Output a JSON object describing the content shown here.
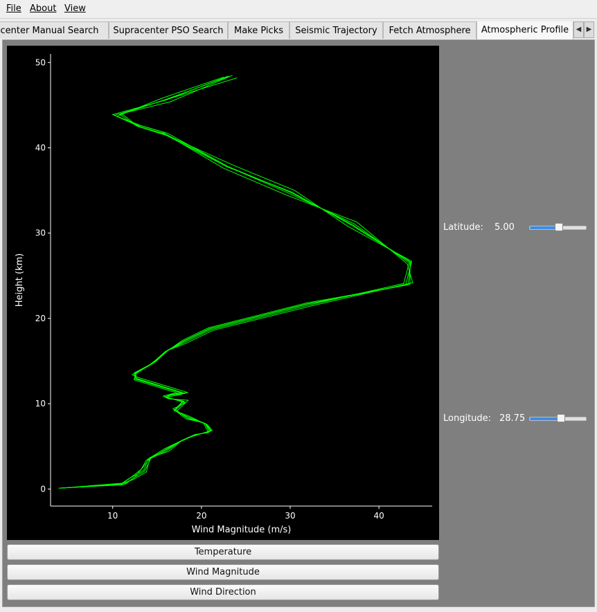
{
  "menu": {
    "file": "File",
    "about": "About",
    "view": "View"
  },
  "tabs": [
    {
      "label": "Supracenter Manual Search"
    },
    {
      "label": "Supracenter PSO Search"
    },
    {
      "label": "Make Picks"
    },
    {
      "label": "Seismic Trajectory"
    },
    {
      "label": "Fetch Atmosphere"
    },
    {
      "label": "Atmospheric Profile"
    }
  ],
  "tab_scroll": {
    "left_icon": "triangle-left",
    "right_icon": "triangle-right"
  },
  "buttons": {
    "temperature": "Temperature",
    "wind_magnitude": "Wind Magnitude",
    "wind_direction": "Wind Direction"
  },
  "controls": {
    "latitude_label": "Latitude:",
    "latitude_value": "5.00",
    "latitude_position": 0.52,
    "longitude_label": "Longitude:",
    "longitude_value": "28.75",
    "longitude_position": 0.56
  },
  "colors": {
    "plot_background": "#000000",
    "line": "#00ff00",
    "axis": "#ffffff",
    "slider_fill": "#3a8ee6",
    "panel": "#7f7f7f"
  },
  "chart_data": {
    "type": "line",
    "xlabel": "Wind Magnitude (m/s)",
    "ylabel": "Height (km)",
    "xlim": [
      3,
      46
    ],
    "ylim": [
      -2,
      51
    ],
    "xticks": [
      10,
      20,
      30,
      40
    ],
    "yticks": [
      0,
      10,
      20,
      30,
      40,
      50
    ],
    "grid": false,
    "series": [
      {
        "x": [
          4.0,
          11.0,
          12.0,
          13.5,
          14.0,
          16.0,
          17.5,
          19.0,
          21.0,
          20.5,
          18.5,
          17.0,
          18.0,
          16.0,
          16.5,
          18.0,
          12.5,
          12.5,
          14.5,
          16.0,
          18.0,
          21.0,
          32.0,
          43.5,
          43.5,
          37.0,
          30.0,
          23.0,
          16.0,
          13.0,
          10.0,
          16.0,
          23.0
        ],
        "y": [
          0.1,
          0.6,
          1.3,
          2.2,
          3.5,
          4.6,
          5.5,
          6.2,
          6.8,
          7.6,
          8.4,
          9.2,
          10.3,
          10.7,
          11.0,
          11.2,
          12.9,
          13.5,
          14.7,
          16.1,
          17.3,
          18.8,
          21.7,
          24.0,
          26.6,
          31.0,
          34.8,
          37.8,
          41.6,
          42.5,
          43.9,
          45.6,
          48.4
        ]
      },
      {
        "x": [
          4.2,
          11.2,
          12.3,
          13.8,
          14.2,
          16.3,
          17.8,
          19.3,
          20.8,
          20.2,
          18.3,
          16.8,
          18.2,
          15.7,
          16.8,
          18.5,
          12.8,
          12.2,
          14.8,
          16.3,
          18.3,
          21.3,
          32.5,
          43.8,
          43.2,
          37.5,
          29.5,
          22.5,
          15.5,
          12.5,
          11.0,
          16.5,
          23.5
        ],
        "y": [
          0.1,
          0.7,
          1.1,
          2.0,
          3.7,
          4.4,
          5.7,
          6.4,
          6.6,
          7.8,
          8.2,
          9.4,
          10.1,
          10.9,
          11.2,
          11.3,
          13.1,
          13.4,
          14.9,
          16.3,
          17.1,
          18.6,
          21.5,
          24.2,
          26.4,
          31.3,
          34.5,
          37.6,
          41.9,
          42.8,
          44.0,
          45.4,
          48.5
        ]
      },
      {
        "x": [
          3.9,
          10.8,
          12.1,
          13.2,
          13.8,
          15.8,
          17.2,
          18.8,
          21.2,
          20.7,
          18.7,
          17.2,
          18.5,
          16.2,
          16.2,
          17.8,
          12.4,
          12.7,
          14.2,
          15.8,
          17.8,
          20.8,
          31.8,
          43.0,
          43.7,
          36.5,
          30.5,
          23.5,
          16.5,
          13.5,
          10.5,
          15.5,
          22.5
        ],
        "y": [
          0.1,
          0.5,
          1.4,
          2.3,
          3.4,
          4.7,
          5.4,
          6.1,
          6.9,
          7.5,
          8.5,
          9.1,
          10.4,
          10.6,
          10.8,
          11.1,
          12.8,
          13.7,
          14.6,
          15.9,
          17.4,
          18.9,
          21.8,
          23.9,
          26.7,
          30.8,
          35.0,
          38.0,
          41.3,
          42.3,
          43.7,
          45.8,
          48.3
        ]
      },
      {
        "x": [
          4.1,
          11.5,
          12.2,
          13.6,
          14.3,
          16.1,
          17.6,
          19.1,
          20.9,
          20.4,
          18.4,
          17.1,
          18.1,
          15.9,
          16.6,
          18.2,
          12.6,
          12.4,
          14.6,
          16.1,
          18.1,
          21.1,
          32.2,
          42.8,
          43.4,
          37.2,
          29.8,
          23.2,
          16.2,
          13.2,
          10.2,
          16.2,
          24.0
        ],
        "y": [
          0.1,
          0.6,
          1.2,
          2.1,
          3.6,
          4.5,
          5.6,
          6.3,
          6.7,
          7.7,
          8.3,
          9.3,
          10.2,
          10.8,
          11.1,
          11.2,
          13.0,
          13.6,
          14.8,
          16.2,
          17.2,
          18.7,
          21.6,
          24.1,
          26.5,
          31.1,
          34.7,
          37.7,
          41.7,
          42.6,
          43.8,
          45.7,
          48.2
        ]
      },
      {
        "x": [
          4.0,
          11.1,
          12.4,
          13.3,
          14.1,
          15.9,
          17.4,
          18.9,
          21.1,
          20.6,
          18.6,
          16.9,
          17.9,
          16.1,
          16.4,
          18.1,
          12.7,
          12.6,
          14.4,
          15.9,
          17.9,
          20.9,
          31.9,
          43.3,
          43.6,
          36.8,
          30.2,
          22.8,
          15.8,
          12.8,
          10.8,
          15.8,
          23.2
        ],
        "y": [
          0.1,
          0.5,
          1.3,
          2.4,
          3.5,
          4.6,
          5.5,
          6.2,
          6.8,
          7.6,
          8.4,
          9.2,
          10.3,
          10.7,
          11.0,
          11.2,
          12.9,
          13.5,
          14.7,
          16.1,
          17.3,
          18.8,
          21.7,
          24.0,
          26.6,
          31.0,
          34.8,
          37.8,
          41.6,
          42.5,
          43.9,
          45.6,
          48.4
        ]
      }
    ]
  }
}
